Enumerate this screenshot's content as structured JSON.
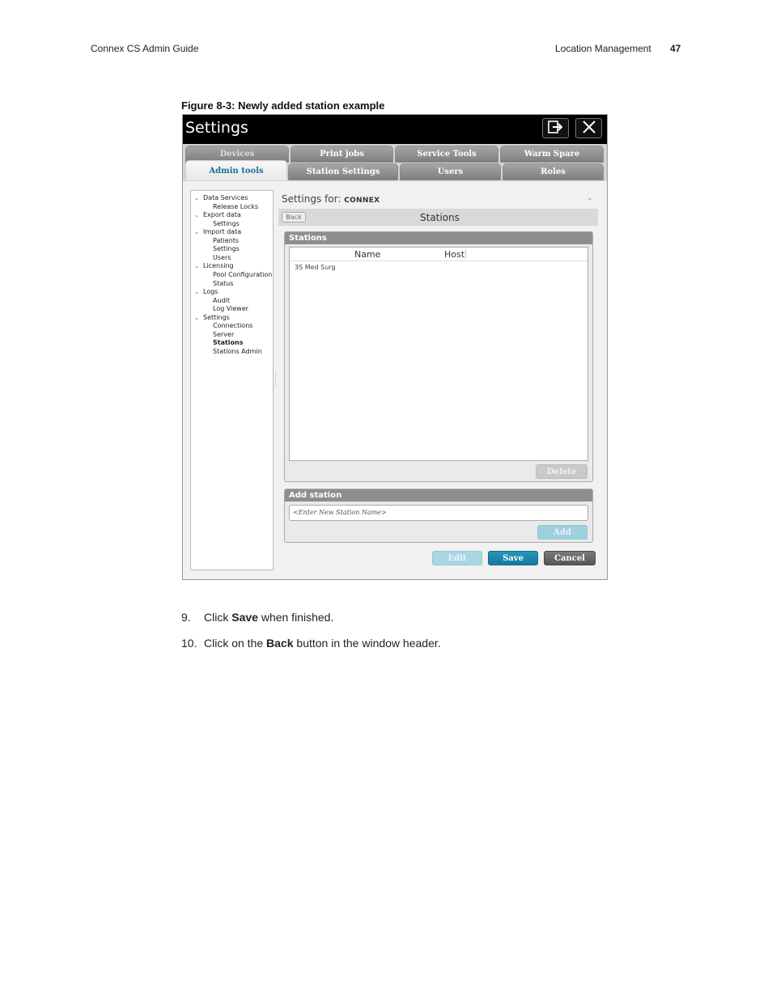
{
  "page_header": {
    "left": "Connex CS Admin Guide",
    "section": "Location Management",
    "page_number": "47"
  },
  "figure_caption": "Figure 8-3: Newly added station example",
  "app": {
    "title": "Settings",
    "tabs_row1": [
      "Devices",
      "Print jobs",
      "Service Tools",
      "Warm Spare"
    ],
    "tabs_row2": [
      "Admin tools",
      "Station Settings",
      "Users",
      "Roles"
    ],
    "active_tab": "Admin tools",
    "tree": [
      {
        "label": "Data Services",
        "level": 1,
        "expanded": true
      },
      {
        "label": "Release Locks",
        "level": 2
      },
      {
        "label": "Export data",
        "level": 1,
        "expanded": true
      },
      {
        "label": "Settings",
        "level": 2
      },
      {
        "label": "Import data",
        "level": 1,
        "expanded": true
      },
      {
        "label": "Patients",
        "level": 2
      },
      {
        "label": "Settings",
        "level": 2
      },
      {
        "label": "Users",
        "level": 2
      },
      {
        "label": "Licensing",
        "level": 1,
        "expanded": true
      },
      {
        "label": "Pool Configuration",
        "level": 2
      },
      {
        "label": "Status",
        "level": 2
      },
      {
        "label": "Logs",
        "level": 1,
        "expanded": true
      },
      {
        "label": "Audit",
        "level": 2
      },
      {
        "label": "Log Viewer",
        "level": 2
      },
      {
        "label": "Settings",
        "level": 1,
        "expanded": true
      },
      {
        "label": "Connections",
        "level": 2
      },
      {
        "label": "Server",
        "level": 2
      },
      {
        "label": "Stations",
        "level": 2,
        "selected": true
      },
      {
        "label": "Stations Admin",
        "level": 2
      }
    ],
    "settings_for_label": "Settings for:",
    "settings_for_value": "CONNEX",
    "back_label": "Back",
    "subheader_title": "Stations",
    "stations_panel": {
      "title": "Stations",
      "columns": [
        "Name",
        "Host"
      ],
      "rows": [
        [
          "3S Med Surg",
          ""
        ]
      ],
      "delete_label": "Delete"
    },
    "add_station_panel": {
      "title": "Add station",
      "placeholder": "<Enter New Station Name>",
      "add_label": "Add"
    },
    "footer_buttons": {
      "edit": "Edit",
      "save": "Save",
      "cancel": "Cancel"
    }
  },
  "steps": [
    {
      "number": "9.",
      "before": "Click ",
      "bold": "Save",
      "after": " when finished."
    },
    {
      "number": "10.",
      "before": "Click on the ",
      "bold": "Back",
      "after": " button in the window header."
    }
  ]
}
